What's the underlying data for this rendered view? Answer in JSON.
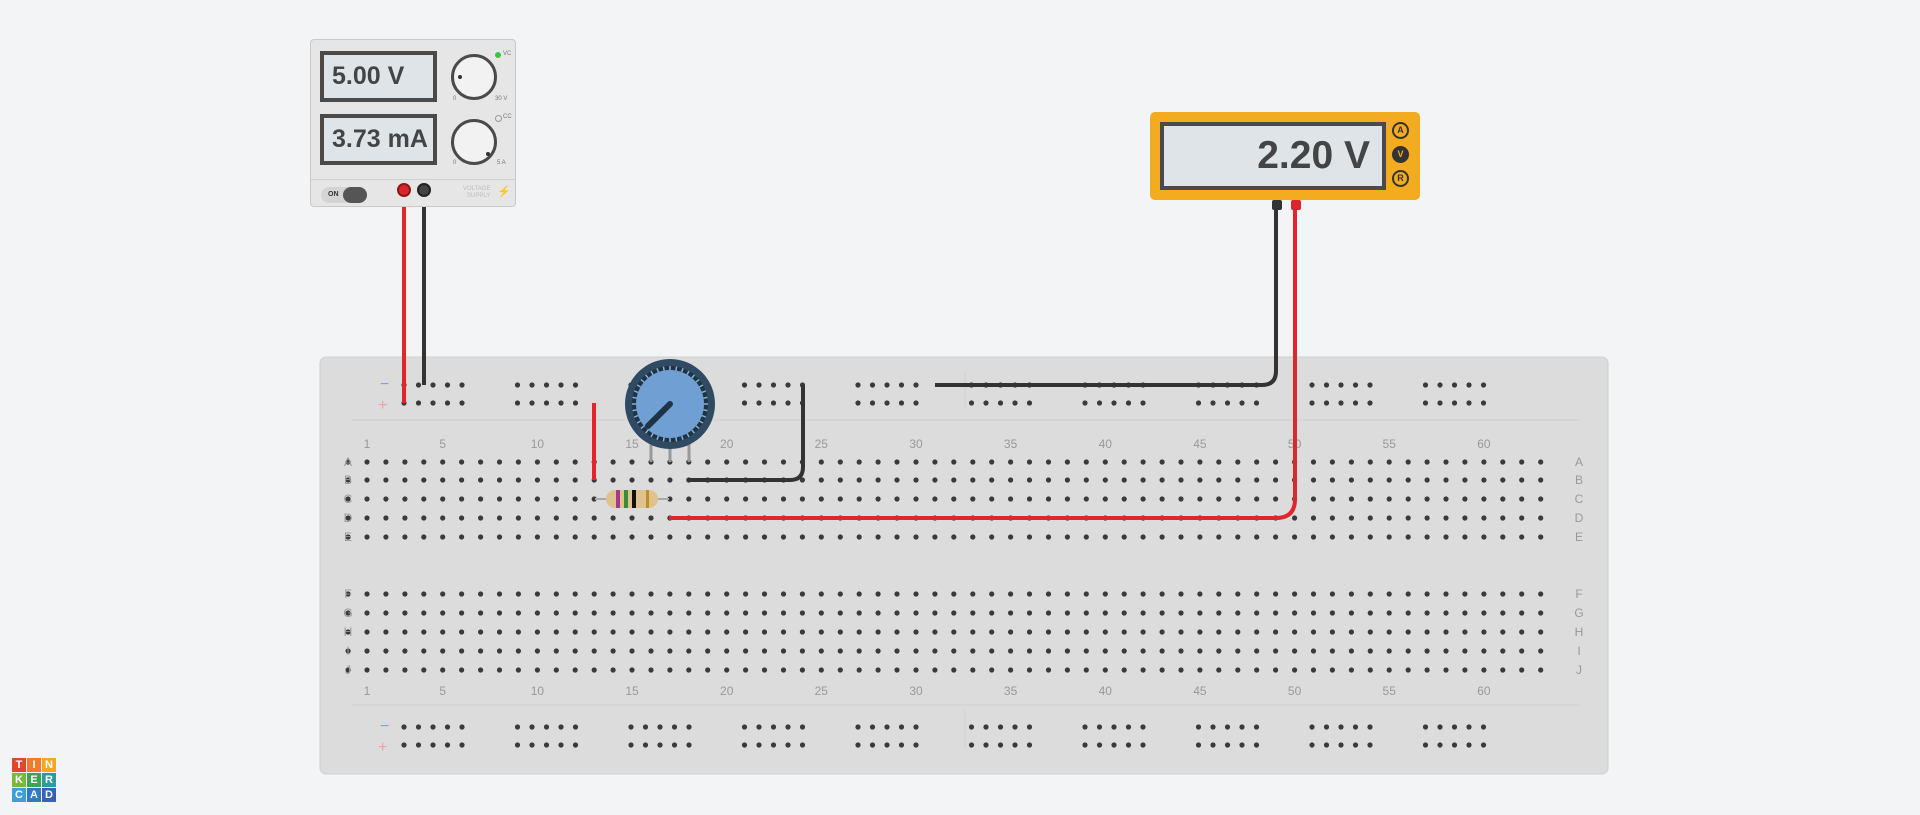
{
  "power_supply": {
    "voltage_display": "5.00 V",
    "current_display": "3.73 mA",
    "cv_label": "VC",
    "cc_label": "CC",
    "voltage_min": "0",
    "voltage_max": "30 V",
    "current_min": "0",
    "current_max": "5 A",
    "on_label": "ON",
    "brand_label_line1": "VOLTAGE",
    "brand_label_line2": "SUPPLY"
  },
  "multimeter": {
    "display": "2.20 V",
    "modes": [
      "A",
      "V",
      "R"
    ],
    "active_mode": "V"
  },
  "breadboard": {
    "column_numbers": [
      "1",
      "5",
      "10",
      "15",
      "20",
      "25",
      "30",
      "35",
      "40",
      "45",
      "50",
      "55",
      "60"
    ],
    "rows_top": [
      "A",
      "B",
      "C",
      "D",
      "E"
    ],
    "rows_bottom": [
      "F",
      "G",
      "H",
      "I",
      "J"
    ],
    "rail_minus": "−",
    "rail_plus": "+"
  },
  "logo": {
    "letters": [
      "T",
      "I",
      "N",
      "K",
      "E",
      "R",
      "C",
      "A",
      "D"
    ]
  },
  "colors": {
    "background": "#f3f4f6",
    "breadboard": "#dcdcdc",
    "wire_red": "#e0262a",
    "wire_black": "#333333",
    "meter_body": "#f3ac1f",
    "pot_knob": "#6f9fd3",
    "pot_body": "#2f4a63",
    "rail_minus": "#7aa7d8",
    "rail_plus": "#f4a0a0"
  }
}
